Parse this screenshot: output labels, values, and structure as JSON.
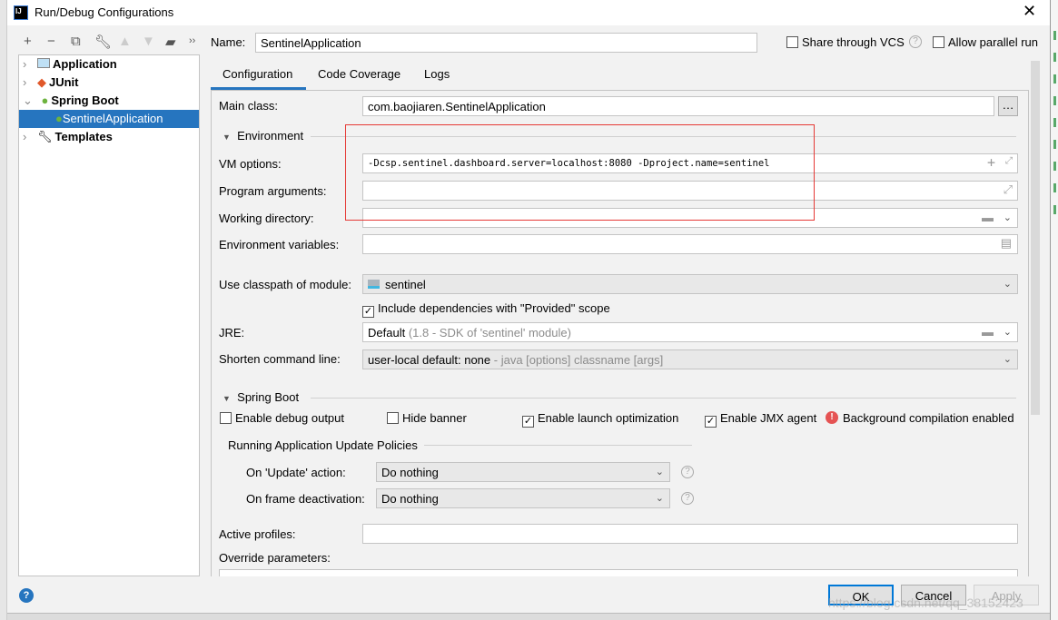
{
  "window": {
    "title": "Run/Debug Configurations",
    "app_icon": "IJ"
  },
  "toolbar": {
    "icons": [
      "plus-icon",
      "minus-icon",
      "copy-icon",
      "wrench-icon",
      "arrow-up-icon",
      "arrow-down-icon",
      "folder-add-icon",
      "more-icon"
    ]
  },
  "tree": [
    {
      "label": "Application",
      "expanded": false
    },
    {
      "label": "JUnit",
      "expanded": false
    },
    {
      "label": "Spring Boot",
      "expanded": true
    },
    {
      "label": "SentinelApplication",
      "selected": true
    },
    {
      "label": "Templates",
      "expanded": false
    }
  ],
  "name": {
    "label": "Name:",
    "value": "SentinelApplication"
  },
  "share_vcs": {
    "label": "Share through VCS",
    "checked": false
  },
  "allow_parallel": {
    "label": "Allow parallel run",
    "checked": false
  },
  "tabs": [
    {
      "label": "Configuration",
      "active": true
    },
    {
      "label": "Code Coverage"
    },
    {
      "label": "Logs"
    }
  ],
  "form": {
    "main_class": {
      "label": "Main class:",
      "value": "com.baojiaren.SentinelApplication"
    },
    "environment": "Environment",
    "vm_options": {
      "label": "VM options:",
      "value": "-Dcsp.sentinel.dashboard.server=localhost:8080 -Dproject.name=sentinel"
    },
    "program_arguments": {
      "label": "Program arguments:",
      "value": ""
    },
    "working_directory": {
      "label": "Working directory:",
      "value": ""
    },
    "env_vars": {
      "label": "Environment variables:",
      "value": ""
    },
    "classpath": {
      "label": "Use classpath of module:",
      "value": "sentinel"
    },
    "include_provided": {
      "label": "Include dependencies with \"Provided\" scope",
      "checked": true
    },
    "jre": {
      "label": "JRE:",
      "value": "Default",
      "hint": "(1.8 - SDK of 'sentinel' module)"
    },
    "shorten": {
      "label": "Shorten command line:",
      "value": "user-local default: none",
      "hint": "- java [options] classname [args]"
    },
    "spring_boot": "Spring Boot",
    "debug_output": {
      "label": "Enable debug output",
      "checked": false
    },
    "hide_banner": {
      "label": "Hide banner",
      "checked": false
    },
    "launch_opt": {
      "label": "Enable launch optimization",
      "checked": true
    },
    "jmx": {
      "label": "Enable JMX agent",
      "checked": true
    },
    "bg_compile": "Background compilation enabled",
    "update_policies": "Running Application Update Policies",
    "on_update": {
      "label": "On 'Update' action:",
      "value": "Do nothing"
    },
    "on_frame": {
      "label": "On frame deactivation:",
      "value": "Do nothing"
    },
    "active_profiles": {
      "label": "Active profiles:",
      "value": ""
    },
    "override": "Override parameters:"
  },
  "buttons": {
    "ok": "OK",
    "cancel": "Cancel",
    "apply": "Apply"
  },
  "watermark": "https://blog.csdn.net/qq_38152423",
  "colors": {
    "accent": "#2675bf",
    "selection": "#2675bf",
    "highlight_box": "#e53935"
  }
}
